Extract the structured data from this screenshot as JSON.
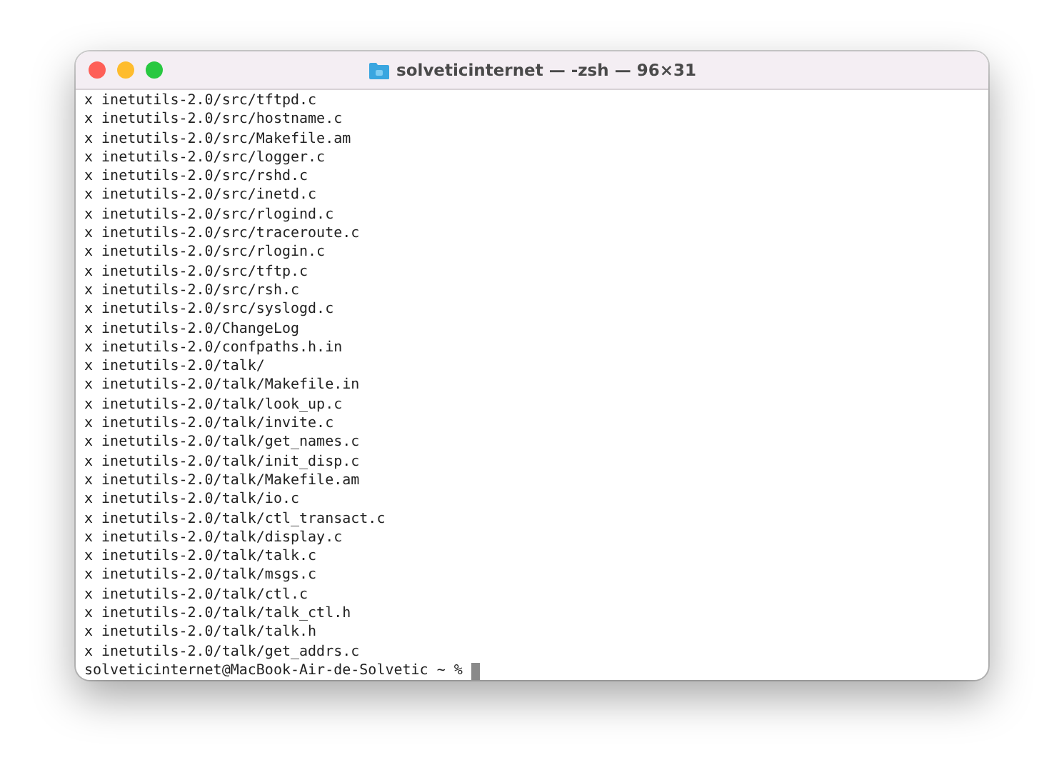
{
  "window": {
    "title": "solveticinternet — -zsh — 96×31"
  },
  "traffic_lights": [
    {
      "color": "#fe5f57"
    },
    {
      "color": "#febc2e"
    },
    {
      "color": "#28c840"
    }
  ],
  "terminal": {
    "lines": [
      "x inetutils-2.0/src/tftpd.c",
      "x inetutils-2.0/src/hostname.c",
      "x inetutils-2.0/src/Makefile.am",
      "x inetutils-2.0/src/logger.c",
      "x inetutils-2.0/src/rshd.c",
      "x inetutils-2.0/src/inetd.c",
      "x inetutils-2.0/src/rlogind.c",
      "x inetutils-2.0/src/traceroute.c",
      "x inetutils-2.0/src/rlogin.c",
      "x inetutils-2.0/src/tftp.c",
      "x inetutils-2.0/src/rsh.c",
      "x inetutils-2.0/src/syslogd.c",
      "x inetutils-2.0/ChangeLog",
      "x inetutils-2.0/confpaths.h.in",
      "x inetutils-2.0/talk/",
      "x inetutils-2.0/talk/Makefile.in",
      "x inetutils-2.0/talk/look_up.c",
      "x inetutils-2.0/talk/invite.c",
      "x inetutils-2.0/talk/get_names.c",
      "x inetutils-2.0/talk/init_disp.c",
      "x inetutils-2.0/talk/Makefile.am",
      "x inetutils-2.0/talk/io.c",
      "x inetutils-2.0/talk/ctl_transact.c",
      "x inetutils-2.0/talk/display.c",
      "x inetutils-2.0/talk/talk.c",
      "x inetutils-2.0/talk/msgs.c",
      "x inetutils-2.0/talk/ctl.c",
      "x inetutils-2.0/talk/talk_ctl.h",
      "x inetutils-2.0/talk/talk.h",
      "x inetutils-2.0/talk/get_addrs.c"
    ],
    "prompt": "solveticinternet@MacBook-Air-de-Solvetic ~ %"
  }
}
